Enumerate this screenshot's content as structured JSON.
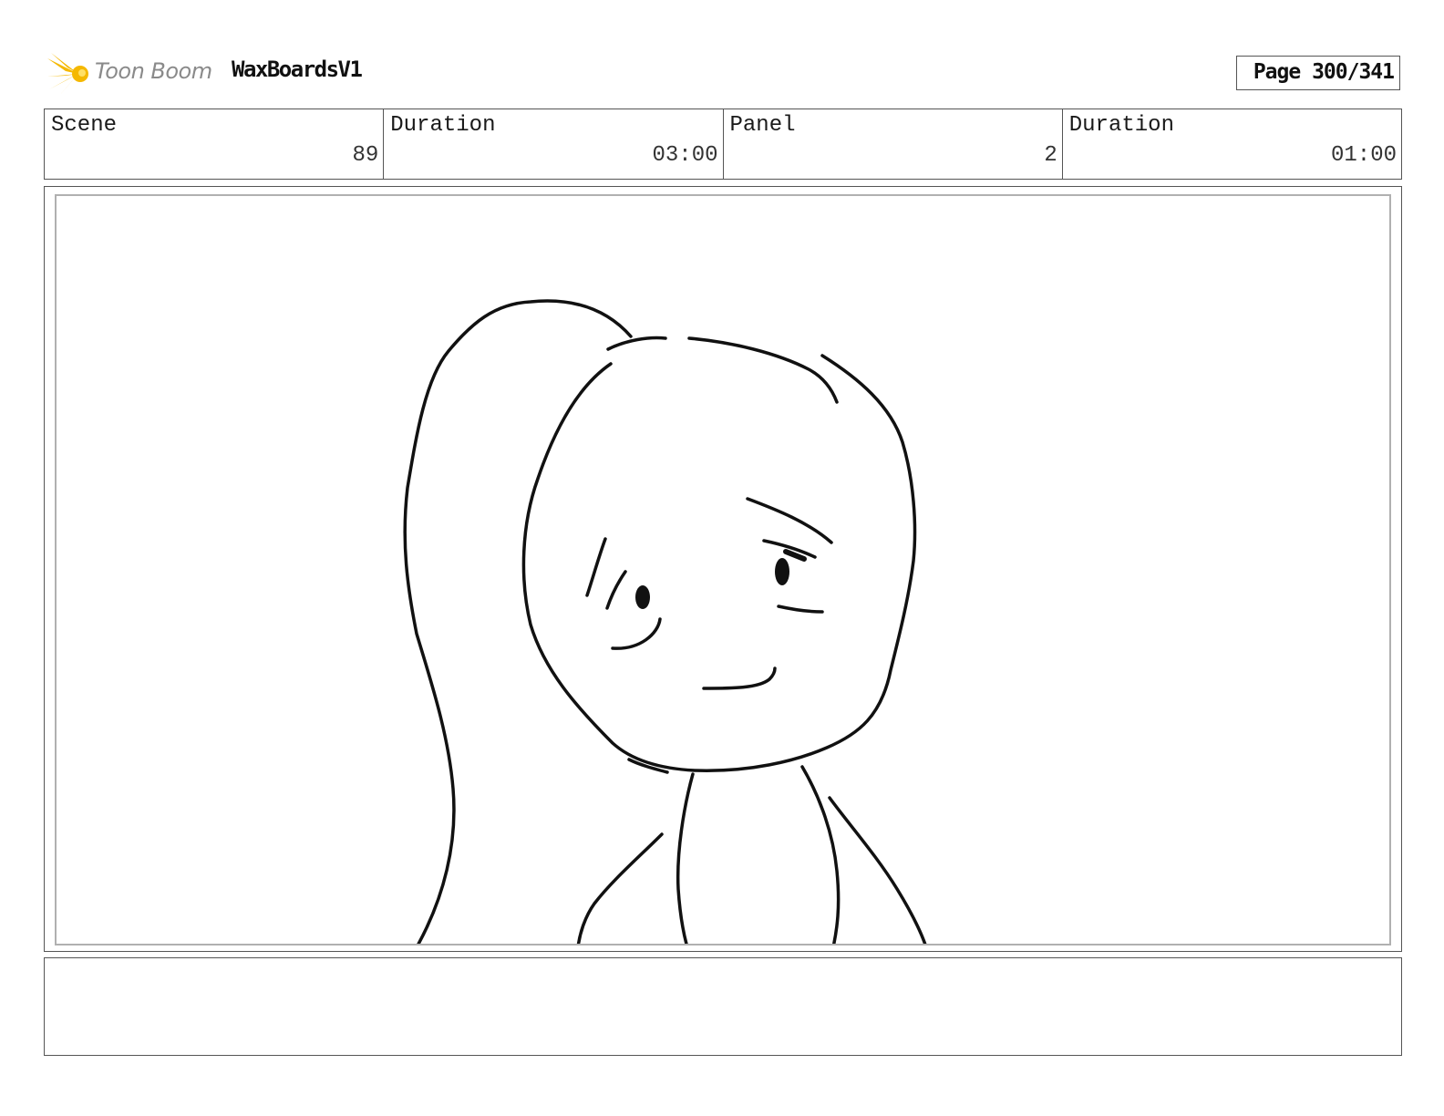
{
  "header": {
    "logo_text": "Toon Boom",
    "project_title": "WaxBoardsV1",
    "page_label": "Page 300/341"
  },
  "info": [
    {
      "label": "Scene",
      "value": "89"
    },
    {
      "label": "Duration",
      "value": "03:00"
    },
    {
      "label": "Panel",
      "value": "2"
    },
    {
      "label": "Duration",
      "value": "01:00"
    }
  ],
  "panel": {
    "drawing": "sketch-character-smiling"
  },
  "notes": {
    "text": ""
  },
  "colors": {
    "logo_star": "#f5b800",
    "border": "#555555",
    "panel_inner_border": "#b0b0b0",
    "ink": "#111111"
  }
}
